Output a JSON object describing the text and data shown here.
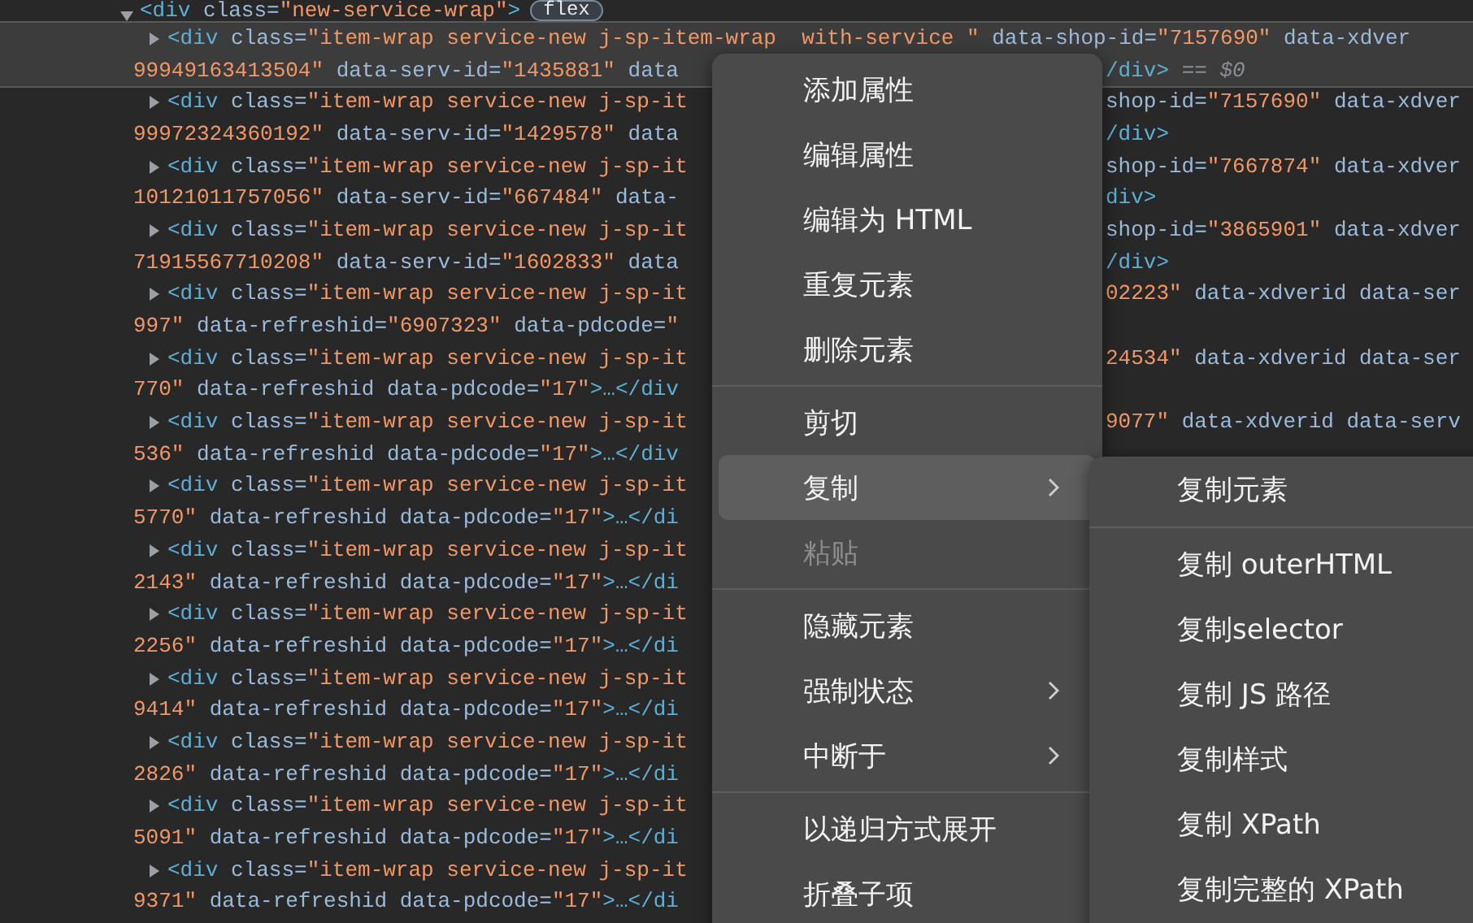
{
  "dom_tree": {
    "expanded": true,
    "code": [
      {
        "kind": "tag",
        "s": "<div"
      },
      {
        "kind": "attr",
        "s": " class="
      },
      {
        "kind": "val",
        "s": "\"new-service-wrap\""
      },
      {
        "kind": "tag",
        "s": ">"
      }
    ],
    "badge": "flex",
    "children": [
      {
        "expanded": false,
        "selected": true,
        "lines": [
          {
            "left": [
              {
                "kind": "tag",
                "s": "<div"
              },
              {
                "kind": "attr",
                "s": " class="
              },
              {
                "kind": "val",
                "s": "\"item-wrap service-new j-sp-item-wrap  with-service \""
              },
              {
                "kind": "attr",
                "s": " data-shop-id="
              },
              {
                "kind": "val",
                "s": "\"7157690\""
              },
              {
                "kind": "attr",
                "s": " data-xdver"
              }
            ]
          },
          {
            "left": [
              {
                "kind": "val",
                "s": "99949163413504\""
              },
              {
                "kind": "attr",
                "s": " data-serv-id="
              },
              {
                "kind": "val",
                "s": "\"1435881\""
              },
              {
                "kind": "attr",
                "s": " data"
              }
            ],
            "right": [
              {
                "kind": "tag",
                "s": "/div>"
              },
              {
                "kind": "dim",
                "s": " == $0"
              }
            ]
          }
        ]
      },
      {
        "expanded": false,
        "selected": false,
        "lines": [
          {
            "left": [
              {
                "kind": "tag",
                "s": "<div"
              },
              {
                "kind": "attr",
                "s": " class="
              },
              {
                "kind": "val",
                "s": "\"item-wrap service-new j-sp-it"
              }
            ],
            "right": [
              {
                "kind": "attr",
                "s": "shop-id="
              },
              {
                "kind": "val",
                "s": "\"7157690\""
              },
              {
                "kind": "attr",
                "s": " data-xdver"
              }
            ]
          },
          {
            "left": [
              {
                "kind": "val",
                "s": "99972324360192\""
              },
              {
                "kind": "attr",
                "s": " data-serv-id="
              },
              {
                "kind": "val",
                "s": "\"1429578\""
              },
              {
                "kind": "attr",
                "s": " data"
              }
            ],
            "right": [
              {
                "kind": "tag",
                "s": "/div>"
              }
            ]
          }
        ]
      },
      {
        "expanded": false,
        "selected": false,
        "lines": [
          {
            "left": [
              {
                "kind": "tag",
                "s": "<div"
              },
              {
                "kind": "attr",
                "s": " class="
              },
              {
                "kind": "val",
                "s": "\"item-wrap service-new j-sp-it"
              }
            ],
            "right": [
              {
                "kind": "attr",
                "s": "shop-id="
              },
              {
                "kind": "val",
                "s": "\"7667874\""
              },
              {
                "kind": "attr",
                "s": " data-xdver"
              }
            ]
          },
          {
            "left": [
              {
                "kind": "val",
                "s": "10121011757056\""
              },
              {
                "kind": "attr",
                "s": " data-serv-id="
              },
              {
                "kind": "val",
                "s": "\"667484\""
              },
              {
                "kind": "attr",
                "s": " data-"
              }
            ],
            "right": [
              {
                "kind": "tag",
                "s": "div>"
              }
            ]
          }
        ]
      },
      {
        "expanded": false,
        "selected": false,
        "lines": [
          {
            "left": [
              {
                "kind": "tag",
                "s": "<div"
              },
              {
                "kind": "attr",
                "s": " class="
              },
              {
                "kind": "val",
                "s": "\"item-wrap service-new j-sp-it"
              }
            ],
            "right": [
              {
                "kind": "attr",
                "s": "shop-id="
              },
              {
                "kind": "val",
                "s": "\"3865901\""
              },
              {
                "kind": "attr",
                "s": " data-xdver"
              }
            ]
          },
          {
            "left": [
              {
                "kind": "val",
                "s": "71915567710208\""
              },
              {
                "kind": "attr",
                "s": " data-serv-id="
              },
              {
                "kind": "val",
                "s": "\"1602833\""
              },
              {
                "kind": "attr",
                "s": " data"
              }
            ],
            "right": [
              {
                "kind": "tag",
                "s": "/div>"
              }
            ]
          }
        ]
      },
      {
        "expanded": false,
        "selected": false,
        "lines": [
          {
            "left": [
              {
                "kind": "tag",
                "s": "<div"
              },
              {
                "kind": "attr",
                "s": " class="
              },
              {
                "kind": "val",
                "s": "\"item-wrap service-new j-sp-it"
              }
            ],
            "right": [
              {
                "kind": "val",
                "s": "02223\""
              },
              {
                "kind": "attr",
                "s": " data-xdverid data-ser"
              }
            ]
          },
          {
            "left": [
              {
                "kind": "val",
                "s": "997\""
              },
              {
                "kind": "attr",
                "s": " data-refreshid="
              },
              {
                "kind": "val",
                "s": "\"6907323\""
              },
              {
                "kind": "attr",
                "s": " data-pdcode="
              },
              {
                "kind": "val",
                "s": "\""
              }
            ]
          }
        ]
      },
      {
        "expanded": false,
        "selected": false,
        "lines": [
          {
            "left": [
              {
                "kind": "tag",
                "s": "<div"
              },
              {
                "kind": "attr",
                "s": " class="
              },
              {
                "kind": "val",
                "s": "\"item-wrap service-new j-sp-it"
              }
            ],
            "right": [
              {
                "kind": "val",
                "s": "24534\""
              },
              {
                "kind": "attr",
                "s": " data-xdverid data-ser"
              }
            ]
          },
          {
            "left": [
              {
                "kind": "val",
                "s": "770\""
              },
              {
                "kind": "attr",
                "s": " data-refreshid data-pdcode="
              },
              {
                "kind": "val",
                "s": "\"17\""
              },
              {
                "kind": "tag",
                "s": ">…</div"
              }
            ]
          }
        ]
      },
      {
        "expanded": false,
        "selected": false,
        "lines": [
          {
            "left": [
              {
                "kind": "tag",
                "s": "<div"
              },
              {
                "kind": "attr",
                "s": " class="
              },
              {
                "kind": "val",
                "s": "\"item-wrap service-new j-sp-it"
              }
            ],
            "right": [
              {
                "kind": "val",
                "s": "9077\""
              },
              {
                "kind": "attr",
                "s": " data-xdverid data-serv"
              }
            ]
          },
          {
            "left": [
              {
                "kind": "val",
                "s": "536\""
              },
              {
                "kind": "attr",
                "s": " data-refreshid data-pdcode="
              },
              {
                "kind": "val",
                "s": "\"17\""
              },
              {
                "kind": "tag",
                "s": ">…</div"
              }
            ]
          }
        ]
      },
      {
        "expanded": false,
        "selected": false,
        "lines": [
          {
            "left": [
              {
                "kind": "tag",
                "s": "<div"
              },
              {
                "kind": "attr",
                "s": " class="
              },
              {
                "kind": "val",
                "s": "\"item-wrap service-new j-sp-it"
              }
            ]
          },
          {
            "left": [
              {
                "kind": "val",
                "s": "5770\""
              },
              {
                "kind": "attr",
                "s": " data-refreshid data-pdcode="
              },
              {
                "kind": "val",
                "s": "\"17\""
              },
              {
                "kind": "tag",
                "s": ">…</di"
              }
            ]
          }
        ]
      },
      {
        "expanded": false,
        "selected": false,
        "lines": [
          {
            "left": [
              {
                "kind": "tag",
                "s": "<div"
              },
              {
                "kind": "attr",
                "s": " class="
              },
              {
                "kind": "val",
                "s": "\"item-wrap service-new j-sp-it"
              }
            ]
          },
          {
            "left": [
              {
                "kind": "val",
                "s": "2143\""
              },
              {
                "kind": "attr",
                "s": " data-refreshid data-pdcode="
              },
              {
                "kind": "val",
                "s": "\"17\""
              },
              {
                "kind": "tag",
                "s": ">…</di"
              }
            ]
          }
        ]
      },
      {
        "expanded": false,
        "selected": false,
        "lines": [
          {
            "left": [
              {
                "kind": "tag",
                "s": "<div"
              },
              {
                "kind": "attr",
                "s": " class="
              },
              {
                "kind": "val",
                "s": "\"item-wrap service-new j-sp-it"
              }
            ]
          },
          {
            "left": [
              {
                "kind": "val",
                "s": "2256\""
              },
              {
                "kind": "attr",
                "s": " data-refreshid data-pdcode="
              },
              {
                "kind": "val",
                "s": "\"17\""
              },
              {
                "kind": "tag",
                "s": ">…</di"
              }
            ]
          }
        ]
      },
      {
        "expanded": false,
        "selected": false,
        "lines": [
          {
            "left": [
              {
                "kind": "tag",
                "s": "<div"
              },
              {
                "kind": "attr",
                "s": " class="
              },
              {
                "kind": "val",
                "s": "\"item-wrap service-new j-sp-it"
              }
            ]
          },
          {
            "left": [
              {
                "kind": "val",
                "s": "9414\""
              },
              {
                "kind": "attr",
                "s": " data-refreshid data-pdcode="
              },
              {
                "kind": "val",
                "s": "\"17\""
              },
              {
                "kind": "tag",
                "s": ">…</di"
              }
            ]
          }
        ]
      },
      {
        "expanded": false,
        "selected": false,
        "lines": [
          {
            "left": [
              {
                "kind": "tag",
                "s": "<div"
              },
              {
                "kind": "attr",
                "s": " class="
              },
              {
                "kind": "val",
                "s": "\"item-wrap service-new j-sp-it"
              }
            ]
          },
          {
            "left": [
              {
                "kind": "val",
                "s": "2826\""
              },
              {
                "kind": "attr",
                "s": " data-refreshid data-pdcode="
              },
              {
                "kind": "val",
                "s": "\"17\""
              },
              {
                "kind": "tag",
                "s": ">…</di"
              }
            ]
          }
        ]
      },
      {
        "expanded": false,
        "selected": false,
        "lines": [
          {
            "left": [
              {
                "kind": "tag",
                "s": "<div"
              },
              {
                "kind": "attr",
                "s": " class="
              },
              {
                "kind": "val",
                "s": "\"item-wrap service-new j-sp-it"
              }
            ]
          },
          {
            "left": [
              {
                "kind": "val",
                "s": "5091\""
              },
              {
                "kind": "attr",
                "s": " data-refreshid data-pdcode="
              },
              {
                "kind": "val",
                "s": "\"17\""
              },
              {
                "kind": "tag",
                "s": ">…</di"
              }
            ]
          }
        ]
      },
      {
        "expanded": false,
        "selected": false,
        "lines": [
          {
            "left": [
              {
                "kind": "tag",
                "s": "<div"
              },
              {
                "kind": "attr",
                "s": " class="
              },
              {
                "kind": "val",
                "s": "\"item-wrap service-new j-sp-it"
              }
            ]
          },
          {
            "left": [
              {
                "kind": "val",
                "s": "9371\""
              },
              {
                "kind": "attr",
                "s": " data-refreshid data-pdcode="
              },
              {
                "kind": "val",
                "s": "\"17\""
              },
              {
                "kind": "tag",
                "s": ">…</di"
              }
            ]
          }
        ]
      }
    ]
  },
  "context_menu": {
    "items": [
      {
        "kind": "item",
        "label": "添加属性",
        "selected": false,
        "disabled": false,
        "submenu": false
      },
      {
        "kind": "item",
        "label": "编辑属性",
        "selected": false,
        "disabled": false,
        "submenu": false
      },
      {
        "kind": "item",
        "label": "编辑为 HTML",
        "selected": false,
        "disabled": false,
        "submenu": false
      },
      {
        "kind": "item",
        "label": "重复元素",
        "selected": false,
        "disabled": false,
        "submenu": false
      },
      {
        "kind": "item",
        "label": "删除元素",
        "selected": false,
        "disabled": false,
        "submenu": false
      },
      {
        "kind": "separator"
      },
      {
        "kind": "item",
        "label": "剪切",
        "selected": false,
        "disabled": false,
        "submenu": false
      },
      {
        "kind": "item",
        "label": "复制",
        "selected": true,
        "disabled": false,
        "submenu": true
      },
      {
        "kind": "item",
        "label": "粘贴",
        "selected": false,
        "disabled": true,
        "submenu": false
      },
      {
        "kind": "separator"
      },
      {
        "kind": "item",
        "label": "隐藏元素",
        "selected": false,
        "disabled": false,
        "submenu": false
      },
      {
        "kind": "item",
        "label": "强制状态",
        "selected": false,
        "disabled": false,
        "submenu": true
      },
      {
        "kind": "item",
        "label": "中断于",
        "selected": false,
        "disabled": false,
        "submenu": true
      },
      {
        "kind": "separator"
      },
      {
        "kind": "item",
        "label": "以递归方式展开",
        "selected": false,
        "disabled": false,
        "submenu": false
      },
      {
        "kind": "item",
        "label": "折叠子项",
        "selected": false,
        "disabled": false,
        "submenu": false
      }
    ]
  },
  "copy_submenu": {
    "items": [
      {
        "kind": "item",
        "label": "复制元素"
      },
      {
        "kind": "separator"
      },
      {
        "kind": "item",
        "label": "复制 outerHTML"
      },
      {
        "kind": "item",
        "label": "复制selector"
      },
      {
        "kind": "item",
        "label": "复制 JS 路径"
      },
      {
        "kind": "item",
        "label": "复制样式"
      },
      {
        "kind": "item",
        "label": "复制 XPath"
      },
      {
        "kind": "item",
        "label": "复制完整的 XPath"
      }
    ]
  }
}
